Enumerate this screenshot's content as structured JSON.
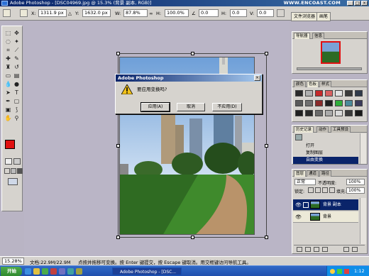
{
  "window": {
    "title": "Adobe Photoshop - [DSC04969.jpg @ 15.3% (背景 副本, RGB)]",
    "watermark": "WWW.ENCOAST.COM"
  },
  "options_bar": {
    "x_label": "X:",
    "x_value": "1311.9 px",
    "y_label": "Y:",
    "y_value": "1632.0 px",
    "w_label": "W:",
    "w_value": "87.8%",
    "h_label": "H:",
    "h_value": "100.0%",
    "angle_value": "0.0",
    "h_skew_label": "H:",
    "h_skew_value": "0.0",
    "v_skew_label": "V:",
    "v_skew_value": "0.0"
  },
  "tab_well": {
    "tabs": [
      "文件浏览器",
      "画笔"
    ]
  },
  "dialog": {
    "title": "Adobe Photoshop",
    "message": "要应用变换吗?",
    "buttons": [
      "应用(A)",
      "取消",
      "不应用(D)"
    ],
    "close_glyph": "×"
  },
  "navigator": {
    "tabs": [
      "导航器",
      "信息"
    ]
  },
  "swatches": {
    "tabs": [
      "颜色",
      "色板",
      "样式"
    ],
    "colors": [
      "#2a2a2a",
      "#b0b0b0",
      "#c52a2a",
      "#d86060",
      "#e2e2e2",
      "#3a3a3a",
      "#303a4a",
      "#5a5a5a",
      "#707070",
      "#8a2a2a",
      "#1f1f1f",
      "#2fae3a",
      "#4a8a9a",
      "#3a3a5a",
      "#202020",
      "#2a2a2a",
      "#6a6a6a",
      "#aaaaaa",
      "#dadada",
      "#3a3a3a",
      "#1a1a1a"
    ]
  },
  "history": {
    "tabs": [
      "历史记录",
      "动作",
      "工具预设"
    ],
    "items": [
      "打开",
      "复制图层",
      "自由变换"
    ]
  },
  "layers": {
    "tabs": [
      "图层",
      "通道",
      "路径"
    ],
    "mode": "正常",
    "opacity_label": "不透明度:",
    "opacity_value": "100%",
    "lock_label": "锁定:",
    "fill_label": "填充:",
    "fill_value": "100%",
    "rows": [
      "背景 副本",
      "背景"
    ]
  },
  "status_bar": {
    "zoom": "15.28%",
    "doc_size": "文档:22.9M/22.9M",
    "hint": "点按并拖移可变换。按 Enter 键提交，按 Escape 键取消。用交框键访问导航工具。"
  },
  "taskbar": {
    "start": "开始",
    "tasks": [
      "Adobe Photoshop - [DSC..."
    ],
    "clock": "1:12"
  }
}
